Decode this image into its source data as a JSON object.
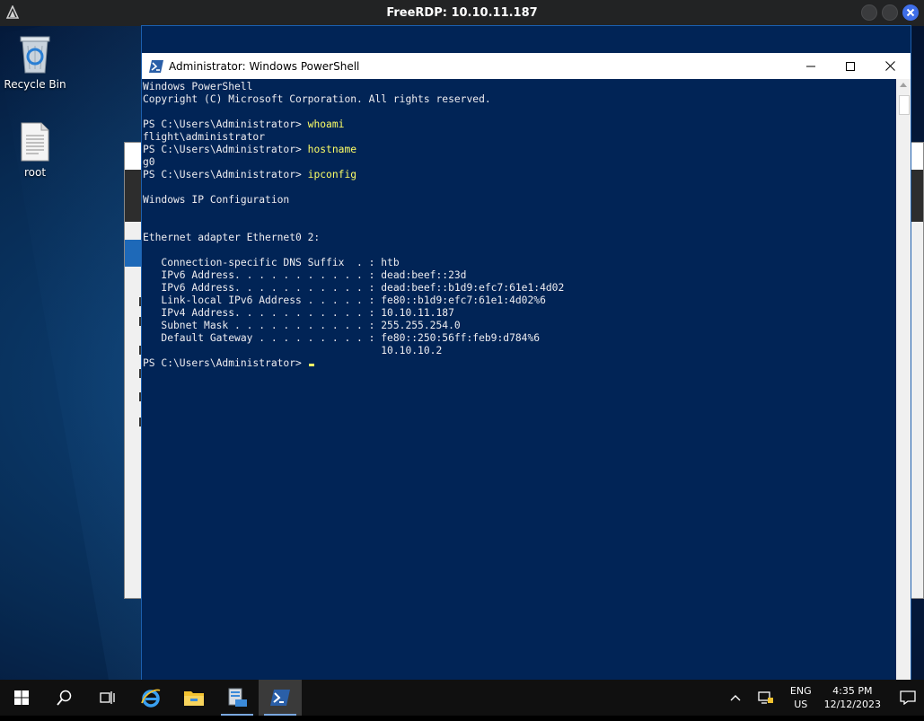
{
  "rdp": {
    "title": "FreeRDP: 10.10.11.187"
  },
  "desktop_icons": [
    {
      "label": "Recycle Bin",
      "icon": "recycle-bin-icon"
    },
    {
      "label": "root",
      "icon": "document-icon"
    }
  ],
  "powershell": {
    "title": "Administrator: Windows PowerShell",
    "lines": [
      {
        "text": "Windows PowerShell"
      },
      {
        "text": "Copyright (C) Microsoft Corporation. All rights reserved."
      },
      {
        "text": ""
      },
      {
        "prompt": "PS C:\\Users\\Administrator> ",
        "cmd": "whoami"
      },
      {
        "text": "flight\\administrator"
      },
      {
        "prompt": "PS C:\\Users\\Administrator> ",
        "cmd": "hostname"
      },
      {
        "text": "g0"
      },
      {
        "prompt": "PS C:\\Users\\Administrator> ",
        "cmd": "ipconfig"
      },
      {
        "text": ""
      },
      {
        "text": "Windows IP Configuration"
      },
      {
        "text": ""
      },
      {
        "text": ""
      },
      {
        "text": "Ethernet adapter Ethernet0 2:"
      },
      {
        "text": ""
      },
      {
        "text": "   Connection-specific DNS Suffix  . : htb"
      },
      {
        "text": "   IPv6 Address. . . . . . . . . . . : dead:beef::23d"
      },
      {
        "text": "   IPv6 Address. . . . . . . . . . . : dead:beef::b1d9:efc7:61e1:4d02"
      },
      {
        "text": "   Link-local IPv6 Address . . . . . : fe80::b1d9:efc7:61e1:4d02%6"
      },
      {
        "text": "   IPv4 Address. . . . . . . . . . . : 10.10.11.187"
      },
      {
        "text": "   Subnet Mask . . . . . . . . . . . : 255.255.254.0"
      },
      {
        "text": "   Default Gateway . . . . . . . . . : fe80::250:56ff:feb9:d784%6"
      },
      {
        "text": "                                       10.10.10.2"
      },
      {
        "prompt": "PS C:\\Users\\Administrator> ",
        "cursor": true
      }
    ]
  },
  "taskbar": {
    "items": [
      "start-icon",
      "search-icon",
      "task-view-icon",
      "internet-explorer-icon",
      "file-explorer-icon",
      "server-manager-icon",
      "powershell-icon"
    ],
    "tray": {
      "lang_line1": "ENG",
      "lang_line2": "US",
      "time": "4:35 PM",
      "date": "12/12/2023"
    }
  },
  "colors": {
    "console_bg": "#012456",
    "console_fg": "#eeedf0",
    "command_fg": "#ffff66"
  }
}
